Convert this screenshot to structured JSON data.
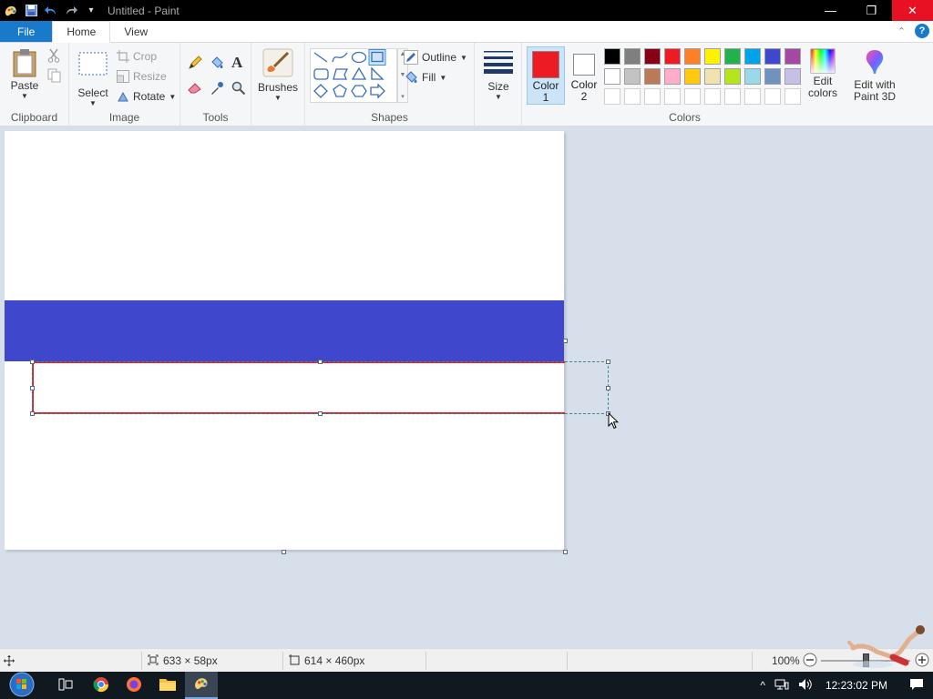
{
  "window": {
    "title": "Untitled - Paint",
    "minimize_icon": "minimize-icon",
    "restore_icon": "restore-icon",
    "close_icon": "close-icon"
  },
  "tabs": {
    "file": "File",
    "home": "Home",
    "view": "View"
  },
  "ribbon": {
    "clipboard": {
      "label": "Clipboard",
      "paste": "Paste"
    },
    "image": {
      "label": "Image",
      "select": "Select",
      "crop": "Crop",
      "resize": "Resize",
      "rotate": "Rotate"
    },
    "tools": {
      "label": "Tools"
    },
    "brushes": {
      "label": "Brushes"
    },
    "shapes": {
      "label": "Shapes",
      "outline": "Outline",
      "fill": "Fill"
    },
    "size": {
      "label": "Size"
    },
    "colors": {
      "label": "Colors",
      "color1_label": "Color",
      "color1_num": "1",
      "color2_label": "Color",
      "color2_num": "2",
      "color1_value": "#ed1c24",
      "color2_value": "#ffffff",
      "edit_colors_line1": "Edit",
      "edit_colors_line2": "colors",
      "paint3d_line1": "Edit with",
      "paint3d_line2": "Paint 3D",
      "palette_row1": [
        "#000000",
        "#7f7f7f",
        "#880015",
        "#ed1c24",
        "#ff7f27",
        "#fff200",
        "#22b14c",
        "#00a2e8",
        "#3f48cc",
        "#a349a4"
      ],
      "palette_row2": [
        "#ffffff",
        "#c3c3c3",
        "#b97a57",
        "#ffaec9",
        "#ffc90e",
        "#efe4b0",
        "#b5e61d",
        "#99d9ea",
        "#7092be",
        "#c8bfe7"
      ]
    }
  },
  "canvas": {
    "band_color": "#3f48cc",
    "rect_outline_color": "#ed1c24"
  },
  "status": {
    "selection_size": "633 × 58px",
    "canvas_size": "614 × 460px",
    "zoom": "100%"
  },
  "taskbar": {
    "clock": "12:23:02 PM"
  }
}
